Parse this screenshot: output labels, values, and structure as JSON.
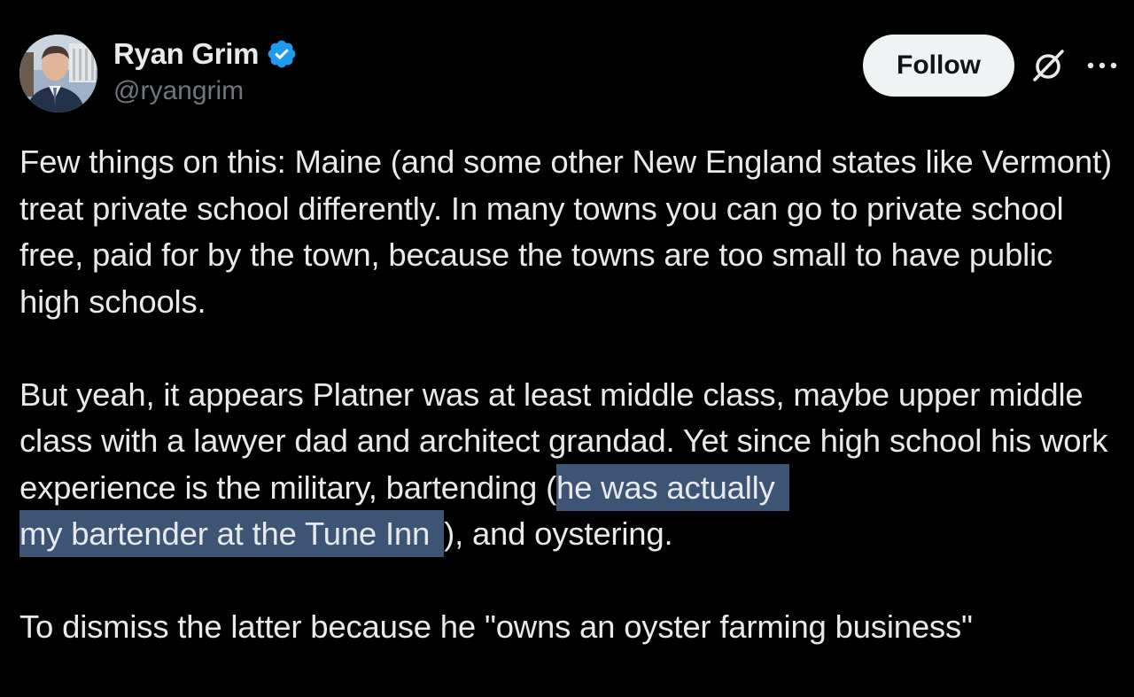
{
  "author": {
    "display_name": "Ryan Grim",
    "handle": "@ryangrim",
    "verified_icon": "verified-badge-icon",
    "avatar_icon": "avatar"
  },
  "actions": {
    "follow_label": "Follow",
    "grok_icon": "grok-icon",
    "more_icon": "more-options-icon"
  },
  "colors": {
    "background": "#000000",
    "text": "#e7e9ea",
    "secondary_text": "#71767b",
    "verified_blue": "#1d9bf0",
    "follow_bg": "#eff3f4",
    "selection_highlight": "#3d5475"
  },
  "post": {
    "p1": "Few things on this: Maine (and some other New England states like Vermont) treat private school differently. In many towns you can go to private school free, paid for by the town, because the towns are too small to have public high schools.",
    "p2_before": "But yeah, it appears Platner was at least middle class, maybe upper middle class with a lawyer dad and architect grandad. Yet since high school his work experience is the military, bartending (",
    "p2_highlight_1": "he was actually",
    "p2_highlight_2": "my bartender at the Tune Inn",
    "p2_after": "), and oystering.",
    "p3": "To dismiss the latter because he \"owns an oyster farming business\""
  }
}
